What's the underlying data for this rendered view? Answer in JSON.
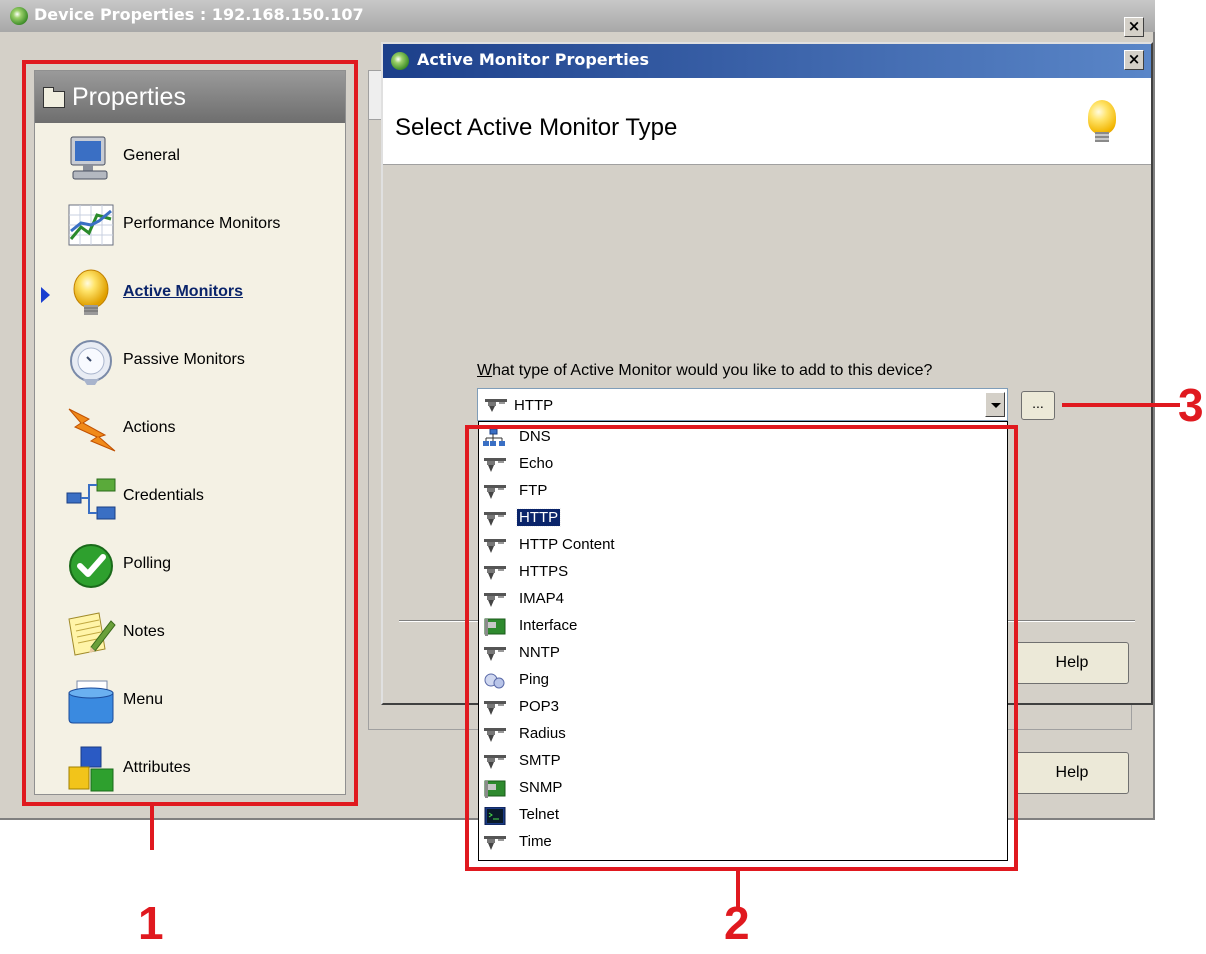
{
  "parent_window": {
    "title": "Device Properties : 192.168.150.107",
    "close_label": "×",
    "help_label": "Help"
  },
  "properties_panel": {
    "header": "Properties",
    "items": [
      {
        "label": "General",
        "icon": "computer-icon"
      },
      {
        "label": "Performance Monitors",
        "icon": "chart-icon"
      },
      {
        "label": "Active Monitors",
        "icon": "lightbulb-icon",
        "active": true
      },
      {
        "label": "Passive Monitors",
        "icon": "satellite-dish-icon"
      },
      {
        "label": "Actions",
        "icon": "lightning-icon"
      },
      {
        "label": "Credentials",
        "icon": "hierarchy-icon"
      },
      {
        "label": "Polling",
        "icon": "checkmark-icon"
      },
      {
        "label": "Notes",
        "icon": "notepad-icon"
      },
      {
        "label": "Menu",
        "icon": "folder-menu-icon"
      },
      {
        "label": "Attributes",
        "icon": "blocks-icon"
      }
    ]
  },
  "dialog": {
    "title": "Active Monitor Properties",
    "close_label": "×",
    "header": "Select Active Monitor Type",
    "question_prefix": "W",
    "question_rest": "hat type of Active Monitor would you like to add to this device?",
    "selected_value": "HTTP",
    "browse_label": "...",
    "help_label": "Help",
    "options": [
      {
        "label": "DNS",
        "icon": "network-icon"
      },
      {
        "label": "Echo",
        "icon": "plug-icon"
      },
      {
        "label": "FTP",
        "icon": "plug-icon"
      },
      {
        "label": "HTTP",
        "icon": "plug-icon",
        "selected": true
      },
      {
        "label": "HTTP Content",
        "icon": "plug-icon"
      },
      {
        "label": "HTTPS",
        "icon": "plug-icon"
      },
      {
        "label": "IMAP4",
        "icon": "plug-icon"
      },
      {
        "label": "Interface",
        "icon": "interface-card-icon"
      },
      {
        "label": "NNTP",
        "icon": "plug-icon"
      },
      {
        "label": "Ping",
        "icon": "ping-icon"
      },
      {
        "label": "POP3",
        "icon": "plug-icon"
      },
      {
        "label": "Radius",
        "icon": "plug-icon"
      },
      {
        "label": "SMTP",
        "icon": "plug-icon"
      },
      {
        "label": "SNMP",
        "icon": "interface-card-icon"
      },
      {
        "label": "Telnet",
        "icon": "terminal-icon"
      },
      {
        "label": "Time",
        "icon": "plug-icon"
      }
    ]
  },
  "annotations": {
    "label_1": "1",
    "label_2": "2",
    "label_3": "3",
    "color": "#e0191f"
  }
}
